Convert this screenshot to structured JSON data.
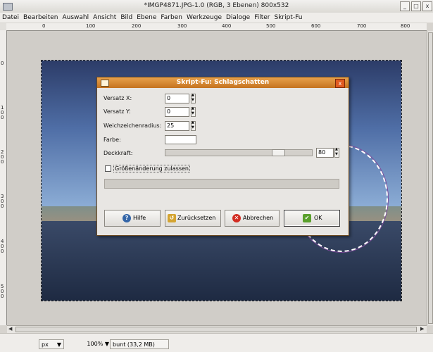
{
  "window": {
    "title": "*IMGP4871.JPG-1.0 (RGB, 3 Ebenen) 800x532",
    "buttons": {
      "minimize": "_",
      "maximize": "□",
      "close": "x"
    }
  },
  "menu": [
    "Datei",
    "Bearbeiten",
    "Auswahl",
    "Ansicht",
    "Bild",
    "Ebene",
    "Farben",
    "Werkzeuge",
    "Dialoge",
    "Filter",
    "Skript-Fu"
  ],
  "rulers": {
    "horizontal": [
      "0",
      "100",
      "200",
      "300",
      "400",
      "500",
      "600",
      "700",
      "800"
    ],
    "vertical": [
      "0",
      "100",
      "200",
      "300",
      "400",
      "500"
    ]
  },
  "statusbar": {
    "unit": "px",
    "zoom": "100%",
    "info": "bunt (33,2 MB)"
  },
  "dialog": {
    "title": "Skript-Fu: Schlagschatten",
    "fields": {
      "offset_x_label": "Versatz X:",
      "offset_x_value": "0",
      "offset_y_label": "Versatz Y:",
      "offset_y_value": "0",
      "blur_label": "Weichzeichenradius:",
      "blur_value": "25",
      "color_label": "Farbe:",
      "color_value": "#ffffff",
      "opacity_label": "Deckkraft:",
      "opacity_value": "80",
      "opacity_fraction": 0.8,
      "resize_label": "Größenänderung zulassen",
      "resize_checked": false
    },
    "buttons": {
      "help": "Hilfe",
      "reset": "Zurücksetzen",
      "cancel": "Abbrechen",
      "ok": "OK"
    }
  },
  "colors": {
    "dialog_title": "#c5731f",
    "selection": "#7d4a9a"
  }
}
